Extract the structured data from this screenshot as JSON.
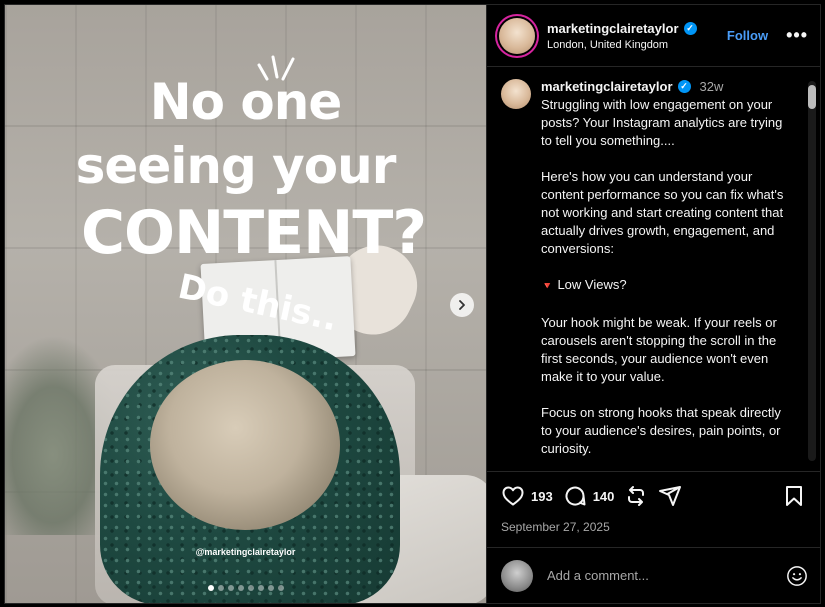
{
  "post": {
    "slide_text": {
      "line1": "No one",
      "line2": "seeing your",
      "line3": "CONTENT?",
      "script": "Do this..",
      "watermark": "@marketingclairetaylor"
    },
    "slides_count": 8,
    "active_slide_index": 1
  },
  "header": {
    "username": "marketingclairetaylor",
    "verified_mark": "✓",
    "location": "London, United Kingdom",
    "follow_label": "Follow",
    "more_label": "•••"
  },
  "caption": {
    "username": "marketingclairetaylor",
    "time_ago": "32w",
    "paragraphs": [
      "Struggling with low engagement on your posts? Your Instagram analytics are trying to tell you something....",
      "Here's how you can understand your content performance so you can fix what's not working and start creating content that actually drives growth, engagement, and conversions:",
      "Your hook might be weak. If your reels or carousels aren't stopping the scroll in the first seconds, your audience won't even make it to your value.",
      "Focus on strong hooks that speak directly to your audience's desires, pain points, or curiosity."
    ],
    "low_views_icon": "🔻",
    "low_views_label": "Low Views?"
  },
  "actions": {
    "likes": "193",
    "comments": "140",
    "date": "September 27, 2025"
  },
  "composer": {
    "placeholder": "Add a comment..."
  },
  "icons": [
    "heart-icon",
    "comment-icon",
    "repost-icon",
    "share-icon",
    "bookmark-icon",
    "emoji-icon",
    "chevron-right-icon",
    "verified-icon",
    "more-icon"
  ],
  "colors": {
    "accent": "#4a9df8",
    "verified": "#0095f6",
    "background": "#000000",
    "muted_text": "#a8a8a8"
  }
}
